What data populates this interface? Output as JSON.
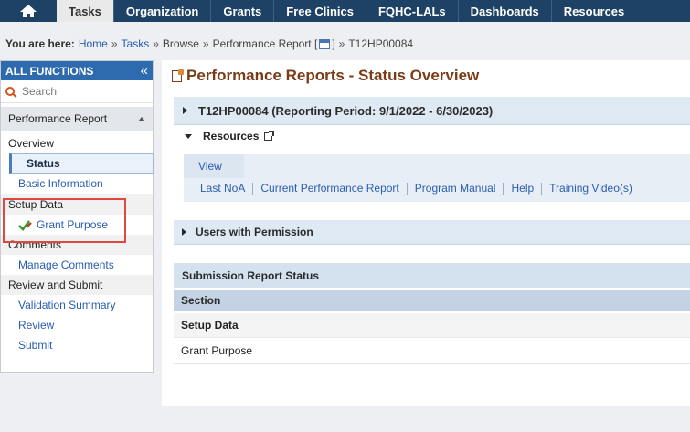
{
  "topnav": {
    "tabs": [
      "Tasks",
      "Organization",
      "Grants",
      "Free Clinics",
      "FQHC-LALs",
      "Dashboards",
      "Resources"
    ],
    "active_tab": "Tasks"
  },
  "breadcrumb": {
    "label": "You are here:",
    "home": "Home",
    "tasks": "Tasks",
    "browse": "Browse",
    "report": "Performance Report [",
    "report_close": "]",
    "current": "T12HP00084"
  },
  "sidebar": {
    "header": "ALL FUNCTIONS",
    "collapse_glyph": "«",
    "search_placeholder": "Search",
    "section": "Performance Report",
    "overview": "Overview",
    "status": "Status",
    "basic_information": "Basic Information",
    "setup_data": "Setup Data",
    "grant_purpose": "Grant Purpose",
    "comments": "Comments",
    "manage_comments": "Manage Comments",
    "review_submit": "Review and Submit",
    "validation_summary": "Validation Summary",
    "review": "Review",
    "submit": "Submit"
  },
  "main": {
    "title": "Performance Reports - Status Overview",
    "period": "T12HP00084 (Reporting Period: 9/1/2022 - 6/30/2023)",
    "resources": "Resources",
    "view_tab": "View",
    "links": [
      "Last NoA",
      "Current Performance Report",
      "Program Manual",
      "Help",
      "Training Video(s)"
    ],
    "users_with_permission": "Users with Permission",
    "submission_status": "Submission Report Status",
    "section_header": "Section",
    "group": "Setup Data",
    "item": "Grant Purpose"
  },
  "colors": {
    "nav_bg": "#1d4266",
    "sidebar_header": "#2d6bae",
    "title": "#7a3b16",
    "link": "#2a5db0",
    "highlight": "#e0483e"
  }
}
